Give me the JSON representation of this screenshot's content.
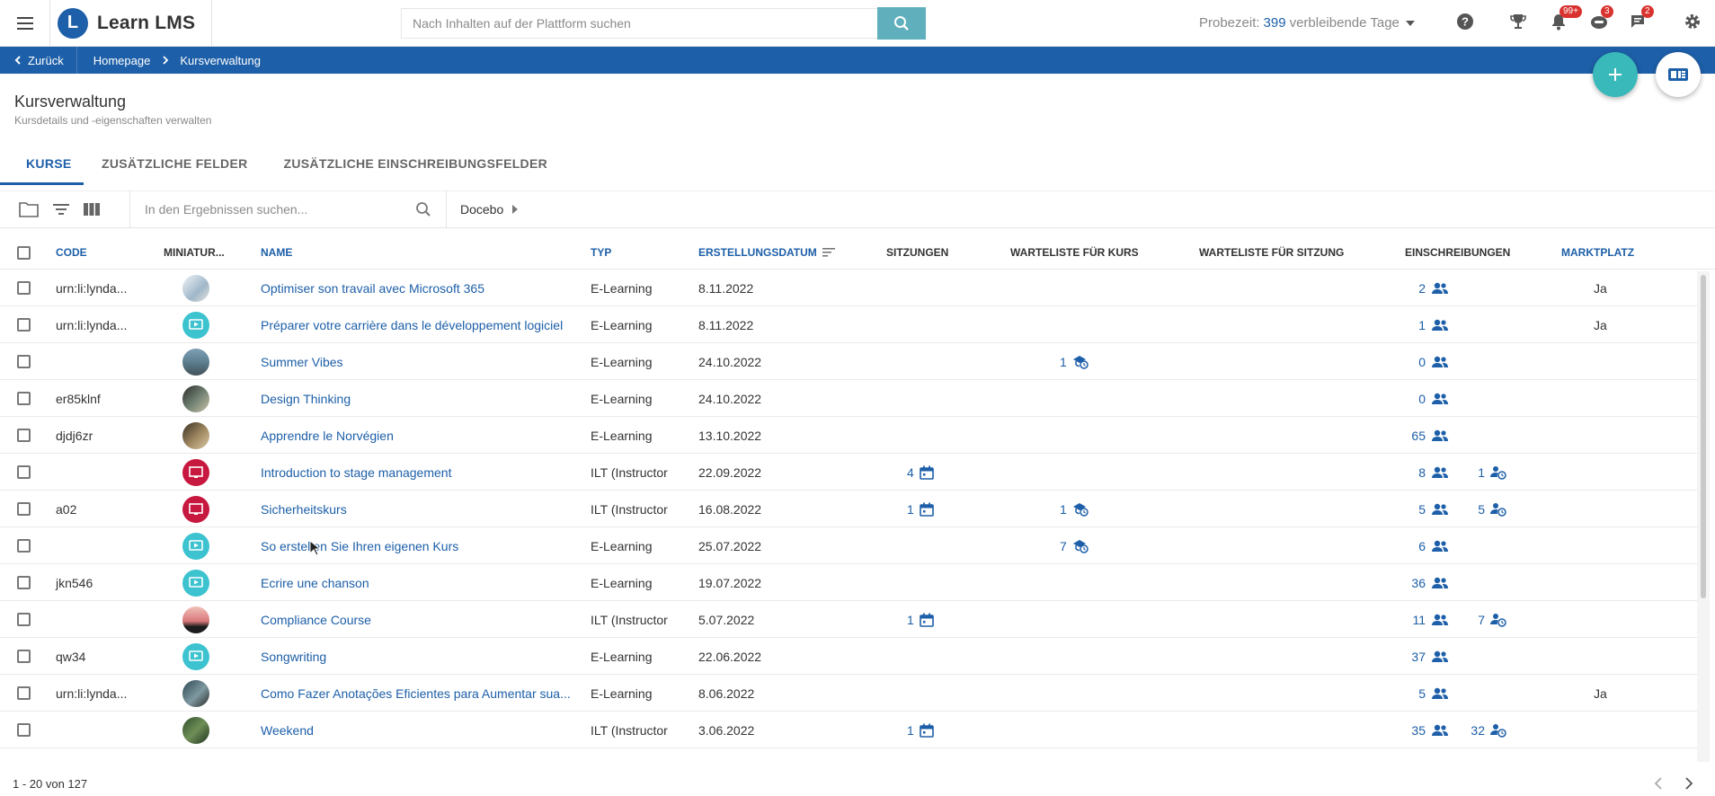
{
  "app": {
    "brand": "Learn LMS",
    "logo_letter": "L",
    "search_placeholder": "Nach Inhalten auf der Plattform suchen",
    "trial_prefix": "Probezeit:",
    "trial_days": "399",
    "trial_suffix": "verbleibende Tage",
    "badges": {
      "notifications": "99+",
      "learning": "3",
      "messages": "2"
    }
  },
  "breadcrumb": {
    "back": "Zurück",
    "items": [
      "Homepage",
      "Kursverwaltung"
    ]
  },
  "page": {
    "title": "Kursverwaltung",
    "subtitle": "Kursdetails und -eigenschaften verwalten"
  },
  "tabs": [
    "KURSE",
    "ZUSÄTZLICHE FELDER",
    "ZUSÄTZLICHE EINSCHREIBUNGSFELDER"
  ],
  "toolbar": {
    "search_placeholder": "In den Ergebnissen suchen...",
    "branch": "Docebo"
  },
  "columns": {
    "code": "CODE",
    "thumb": "MINIATUR...",
    "name": "NAME",
    "type": "TYP",
    "created": "ERSTELLUNGSDATUM",
    "sessions": "SITZUNGEN",
    "waitlist_course": "WARTELISTE FÜR KURS",
    "waitlist_session": "WARTELISTE FÜR SITZUNG",
    "enrollments": "EINSCHREIBUNGEN",
    "marketplace": "MARKTPLATZ"
  },
  "rows": [
    {
      "code": "urn:li:lynda...",
      "thumb": "photo-light",
      "name": "Optimiser son travail avec Microsoft 365",
      "type": "E-Learning",
      "date": "8.11.2022",
      "sessions": "",
      "waitlist": "",
      "enroll": "2",
      "pending": "",
      "market": "Ja"
    },
    {
      "code": "urn:li:lynda...",
      "thumb": "elearning-icon",
      "name": "Préparer votre carrière dans le développement logiciel",
      "type": "E-Learning",
      "date": "8.11.2022",
      "sessions": "",
      "waitlist": "",
      "enroll": "1",
      "pending": "",
      "market": "Ja"
    },
    {
      "code": "",
      "thumb": "photo-sea",
      "name": "Summer Vibes",
      "type": "E-Learning",
      "date": "24.10.2022",
      "sessions": "",
      "waitlist": "1",
      "enroll": "0",
      "pending": "",
      "market": ""
    },
    {
      "code": "er85klnf",
      "thumb": "photo-dark",
      "name": "Design Thinking",
      "type": "E-Learning",
      "date": "24.10.2022",
      "sessions": "",
      "waitlist": "",
      "enroll": "0",
      "pending": "",
      "market": ""
    },
    {
      "code": "djdj6zr",
      "thumb": "photo-brown",
      "name": "Apprendre le Norvégien",
      "type": "E-Learning",
      "date": "13.10.2022",
      "sessions": "",
      "waitlist": "",
      "enroll": "65",
      "pending": "",
      "market": ""
    },
    {
      "code": "",
      "thumb": "ilt-icon",
      "name": "Introduction to stage management",
      "type": "ILT (Instructor",
      "date": "22.09.2022",
      "sessions": "4",
      "waitlist": "",
      "enroll": "8",
      "pending": "1",
      "market": ""
    },
    {
      "code": "a02",
      "thumb": "ilt-icon",
      "name": "Sicherheitskurs",
      "type": "ILT (Instructor",
      "date": "16.08.2022",
      "sessions": "1",
      "waitlist": "1",
      "enroll": "5",
      "pending": "5",
      "market": ""
    },
    {
      "code": "",
      "thumb": "elearning-icon",
      "name": "So erstellen Sie Ihren eigenen Kurs",
      "type": "E-Learning",
      "date": "25.07.2022",
      "sessions": "",
      "waitlist": "7",
      "enroll": "6",
      "pending": "",
      "market": ""
    },
    {
      "code": "jkn546",
      "thumb": "elearning-icon",
      "name": "Ecrire une chanson",
      "type": "E-Learning",
      "date": "19.07.2022",
      "sessions": "",
      "waitlist": "",
      "enroll": "36",
      "pending": "",
      "market": ""
    },
    {
      "code": "",
      "thumb": "photo-sunset",
      "name": "Compliance Course",
      "type": "ILT (Instructor",
      "date": "5.07.2022",
      "sessions": "1",
      "waitlist": "",
      "enroll": "11",
      "pending": "7",
      "market": ""
    },
    {
      "code": "qw34",
      "thumb": "elearning-icon",
      "name": "Songwriting",
      "type": "E-Learning",
      "date": "22.06.2022",
      "sessions": "",
      "waitlist": "",
      "enroll": "37",
      "pending": "",
      "market": ""
    },
    {
      "code": "urn:li:lynda...",
      "thumb": "photo-person",
      "name": "Como Fazer Anotações Eficientes para Aumentar sua...",
      "type": "E-Learning",
      "date": "8.06.2022",
      "sessions": "",
      "waitlist": "",
      "enroll": "5",
      "pending": "",
      "market": "Ja"
    },
    {
      "code": "",
      "thumb": "photo-green",
      "name": "Weekend",
      "type": "ILT (Instructor",
      "date": "3.06.2022",
      "sessions": "1",
      "waitlist": "",
      "enroll": "35",
      "pending": "32",
      "market": ""
    }
  ],
  "footer": {
    "range": "1 - 20 von 127"
  },
  "colors": {
    "primary": "#1d5fa8",
    "accent": "#39b9b9",
    "elearning": "#3cc3cf",
    "ilt": "#c7183f",
    "badge": "#d9332f"
  }
}
